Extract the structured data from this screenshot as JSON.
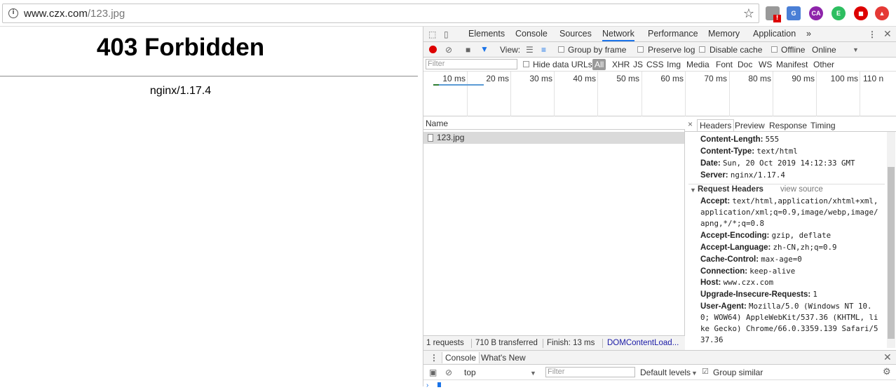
{
  "browser": {
    "url_host": "www.czx.com",
    "url_path": "/123.jpg",
    "ext_badge": "!",
    "ext_ca": "CA"
  },
  "page": {
    "title": "403 Forbidden",
    "server": "nginx/1.17.4"
  },
  "devtools": {
    "tabs": [
      "Elements",
      "Console",
      "Sources",
      "Network",
      "Performance",
      "Memory",
      "Application",
      "»"
    ],
    "active_tab": "Network",
    "toolbar": {
      "view_label": "View:",
      "group_by_frame": "Group by frame",
      "preserve_log": "Preserve log",
      "disable_cache": "Disable cache",
      "offline": "Offline",
      "throttle": "Online"
    },
    "filter_bar": {
      "placeholder": "Filter",
      "hide_data_urls": "Hide data URLs",
      "types": [
        "All",
        "XHR",
        "JS",
        "CSS",
        "Img",
        "Media",
        "Font",
        "Doc",
        "WS",
        "Manifest",
        "Other"
      ]
    },
    "timeline_ticks": [
      "10 ms",
      "20 ms",
      "30 ms",
      "40 ms",
      "50 ms",
      "60 ms",
      "70 ms",
      "80 ms",
      "90 ms",
      "100 ms",
      "110 n"
    ],
    "list": {
      "header": "Name",
      "rows": [
        "123.jpg"
      ]
    },
    "status": {
      "requests": "1 requests",
      "transferred": "710 B transferred",
      "finish": "Finish: 13 ms",
      "dcl": "DOMContentLoad..."
    },
    "detail": {
      "tabs": [
        "Headers",
        "Preview",
        "Response",
        "Timing"
      ],
      "response_headers": [
        {
          "k": "Content-Length:",
          "v": "555"
        },
        {
          "k": "Content-Type:",
          "v": "text/html"
        },
        {
          "k": "Date:",
          "v": "Sun, 20 Oct 2019 14:12:33 GMT"
        },
        {
          "k": "Server:",
          "v": "nginx/1.17.4"
        }
      ],
      "request_title": "Request Headers",
      "view_source": "view source",
      "accept_key": "Accept:",
      "accept_lines": [
        "text/html,application/xhtml+xml,",
        "application/xml;q=0.9,image/webp,image/",
        "apng,*/*;q=0.8"
      ],
      "request_headers": [
        {
          "k": "Accept-Encoding:",
          "v": "gzip, deflate"
        },
        {
          "k": "Accept-Language:",
          "v": "zh-CN,zh;q=0.9"
        },
        {
          "k": "Cache-Control:",
          "v": "max-age=0"
        },
        {
          "k": "Connection:",
          "v": "keep-alive"
        },
        {
          "k": "Host:",
          "v": "www.czx.com"
        },
        {
          "k": "Upgrade-Insecure-Requests:",
          "v": "1"
        }
      ],
      "ua_key": "User-Agent:",
      "ua_lines": [
        "Mozilla/5.0 (Windows NT 10.",
        "0; WOW64) AppleWebKit/537.36 (KHTML, li",
        "ke Gecko) Chrome/66.0.3359.139 Safari/5",
        "37.36"
      ]
    },
    "drawer": {
      "tabs": [
        "Console",
        "What's New"
      ],
      "context": "top",
      "filter_placeholder": "Filter",
      "levels": "Default levels",
      "group_similar": "Group similar"
    }
  }
}
